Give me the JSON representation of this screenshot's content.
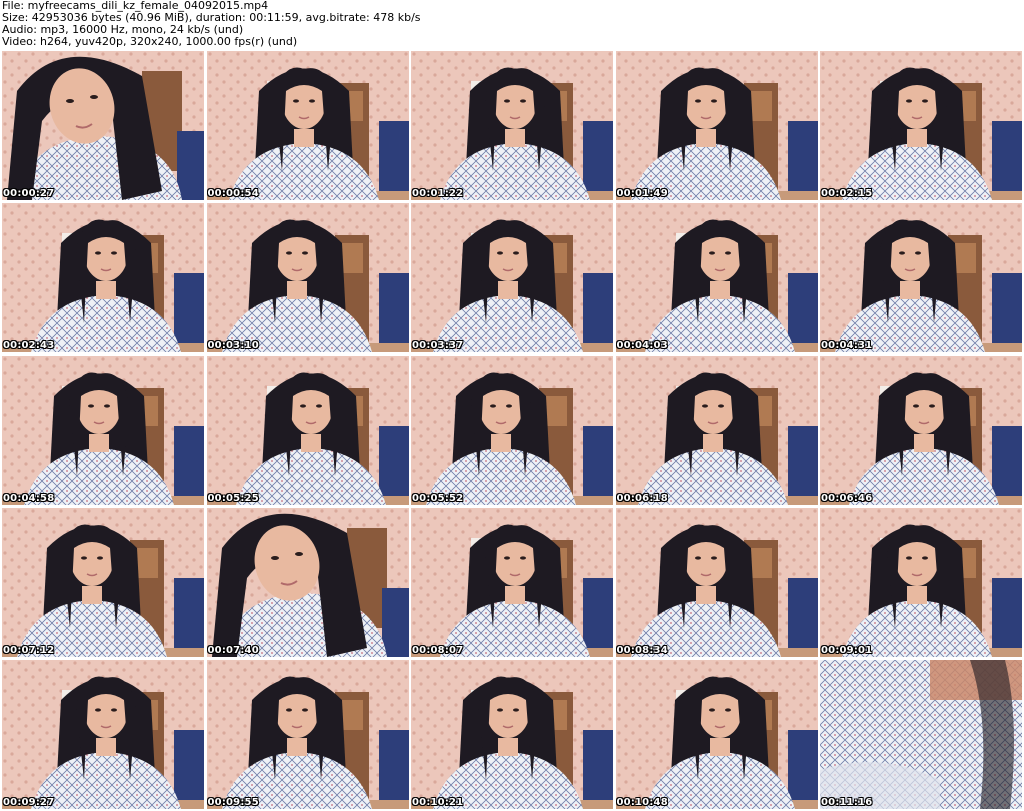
{
  "header": {
    "file_line": "File: myfreecams_dili_kz_female_04092015.mp4",
    "size_line": "Size: 42953036 bytes (40.96 MiB), duration: 00:11:59, avg.bitrate: 478 kb/s",
    "audio_line": "Audio: mp3, 16000 Hz, mono, 24 kb/s (und)",
    "video_line": "Video: h264, yuv420p, 320x240, 1000.00 fps(r) (und)"
  },
  "thumbnails": [
    {
      "time": "00:00:27",
      "variant": "closeup"
    },
    {
      "time": "00:00:54",
      "variant": "center"
    },
    {
      "time": "00:01:22",
      "variant": "center"
    },
    {
      "time": "00:01:49",
      "variant": "center"
    },
    {
      "time": "00:02:15",
      "variant": "center"
    },
    {
      "time": "00:02:43",
      "variant": "center"
    },
    {
      "time": "00:03:10",
      "variant": "center"
    },
    {
      "time": "00:03:37",
      "variant": "center"
    },
    {
      "time": "00:04:03",
      "variant": "center"
    },
    {
      "time": "00:04:31",
      "variant": "center"
    },
    {
      "time": "00:04:58",
      "variant": "center"
    },
    {
      "time": "00:05:25",
      "variant": "center"
    },
    {
      "time": "00:05:52",
      "variant": "center"
    },
    {
      "time": "00:06:18",
      "variant": "center"
    },
    {
      "time": "00:06:46",
      "variant": "center"
    },
    {
      "time": "00:07:12",
      "variant": "center"
    },
    {
      "time": "00:07:40",
      "variant": "closeup"
    },
    {
      "time": "00:08:07",
      "variant": "center"
    },
    {
      "time": "00:08:34",
      "variant": "center"
    },
    {
      "time": "00:09:01",
      "variant": "center"
    },
    {
      "time": "00:09:27",
      "variant": "center"
    },
    {
      "time": "00:09:55",
      "variant": "center"
    },
    {
      "time": "00:10:21",
      "variant": "center"
    },
    {
      "time": "00:10:48",
      "variant": "center"
    },
    {
      "time": "00:11:16",
      "variant": "fabric"
    }
  ],
  "colors": {
    "wallpaper": "#ecc7bb",
    "wallpaper_dots": "#d9a89a",
    "door": "#8a5a3c",
    "chair": "#2d3e7a",
    "skin": "#e8b9a0",
    "hair": "#1e1a22",
    "sweater": "#eef1f6",
    "sweater_pattern": "#6b7aa6"
  }
}
